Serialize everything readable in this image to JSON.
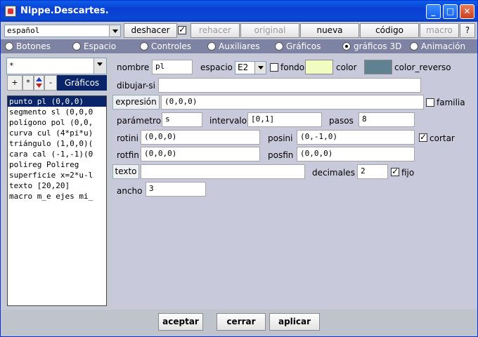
{
  "window": {
    "title": "Nippe.Descartes."
  },
  "toolbar": {
    "language": "español",
    "deshacer": "deshacer",
    "deshacer_checked": true,
    "rehacer": "rehacer",
    "original": "original",
    "nueva": "nueva",
    "codigo": "código",
    "macro": "macro",
    "help": "?"
  },
  "tabs": [
    {
      "label": "Botones",
      "selected": false
    },
    {
      "label": "Espacio",
      "selected": false
    },
    {
      "label": "Controles",
      "selected": false
    },
    {
      "label": "Auxiliares",
      "selected": false
    },
    {
      "label": "Gráficos",
      "selected": false
    },
    {
      "label": "gráficos 3D",
      "selected": true
    },
    {
      "label": "Animación",
      "selected": false
    }
  ],
  "left": {
    "filter": "*",
    "buttons": {
      "add": "+",
      "star": "*",
      "minus": "-",
      "graficos": "Gráficos"
    },
    "list": [
      "punto pl (0,0,0)",
      "segmento sl (0,0,0",
      "polígono pol (0,0,",
      "curva cul (4*pi*u)",
      "triángulo (1,0,0)(",
      "cara cal (-1,-1)(0",
      "polireg Polireg",
      "superficie x=2*u-l",
      "texto [20,20]",
      "macro m_e ejes mi_"
    ]
  },
  "form": {
    "nombre_label": "nombre",
    "nombre_value": "pl",
    "espacio_label": "espacio",
    "espacio_value": "E2",
    "fondo_label": "fondo",
    "color_label": "color",
    "color_hex": "#f0fcc0",
    "color_reverso_label": "color_reverso",
    "color_reverso_hex": "#5f8190",
    "dibujar_si_label": "dibujar-si",
    "dibujar_si_value": "",
    "expresion_label": "expresión",
    "expresion_value": "(0,0,0)",
    "familia_label": "familia",
    "parametro_label": "parámetro",
    "parametro_value": "s",
    "intervalo_label": "intervalo",
    "intervalo_value": "[0,1]",
    "pasos_label": "pasos",
    "pasos_value": "8",
    "rotini_label": "rotini",
    "rotini_value": "(0,0,0)",
    "posini_label": "posini",
    "posini_value": "(0,-1,0)",
    "cortar_label": "cortar",
    "rotfin_label": "rotfin",
    "rotfin_value": "(0,0,0)",
    "posfin_label": "posfin",
    "posfin_value": "(0,0,0)",
    "texto_label": "texto",
    "texto_value": "",
    "decimales_label": "decimales",
    "decimales_value": "2",
    "fijo_label": "fijo",
    "ancho_label": "ancho",
    "ancho_value": "3"
  },
  "bottom": {
    "aceptar": "aceptar",
    "cerrar": "cerrar",
    "aplicar": "aplicar"
  }
}
